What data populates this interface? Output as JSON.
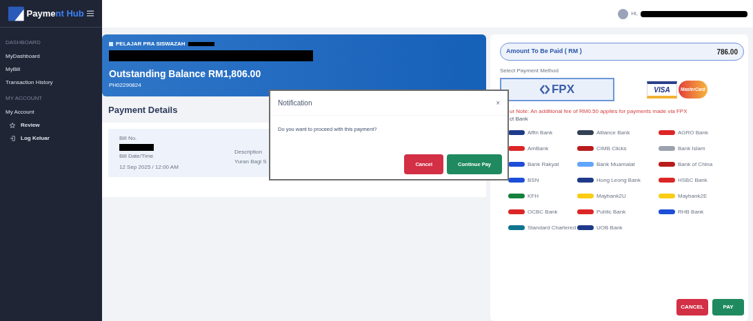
{
  "logo": {
    "parts": [
      {
        "text": "Payme",
        "color": "#ffffff"
      },
      {
        "text": "nt Hub",
        "color": "#3b82f6"
      }
    ]
  },
  "sidebar": {
    "sections": [
      {
        "heading": "DASHBOARD",
        "items": [
          {
            "label": "MyDashboard",
            "kind": "plain"
          },
          {
            "label": "MyBill",
            "kind": "plain"
          },
          {
            "label": "Transaction History",
            "kind": "plain"
          }
        ]
      },
      {
        "heading": "MY ACCOUNT",
        "items": [
          {
            "label": "My Account",
            "kind": "plain"
          },
          {
            "label": "Review",
            "kind": "star"
          },
          {
            "label": "Log Keluar",
            "kind": "logout"
          }
        ]
      }
    ]
  },
  "topbar": {
    "greeting": "Hi,"
  },
  "student_card": {
    "category": "PELAJAR PRA SISWAZAH",
    "balance": "Outstanding Balance RM1,806.00",
    "code": "PH02290824"
  },
  "payment_details": {
    "title": "Payment Details",
    "bill_no_label": "Bill No.",
    "date_label": "Bill Date/Time",
    "date": "12 Sep 2025 / 12:00 AM",
    "description_label": "Description",
    "description": "Yuran Bagi S"
  },
  "modal": {
    "title": "Notification",
    "close": "×",
    "message": "Do you want to proceed with this payment?",
    "buttons": [
      {
        "label": "Cancel",
        "kind": "danger"
      },
      {
        "label": "Continue Pay",
        "kind": "success"
      }
    ]
  },
  "payment": {
    "amount_label": "Amount To Be Paid ( RM )",
    "amount": "786.00",
    "method_label": "Select Payment Method",
    "methods": [
      {
        "kind": "fpx",
        "label": "FPX",
        "selected": true
      },
      {
        "kind": "card",
        "visa": "VISA",
        "mastercard": "MasterCard",
        "selected": false
      }
    ],
    "note": "ur Note: An additional fee of RM0.50 applies for payments made via FPX",
    "bank_label": "ct Bank",
    "banks": [
      {
        "name": "Affin Bank",
        "color": "#1e3a8a"
      },
      {
        "name": "Alliance Bank",
        "color": "#334155"
      },
      {
        "name": "AGRO Bank",
        "color": "#dc2626"
      },
      {
        "name": "AmBank",
        "color": "#dc2626"
      },
      {
        "name": "CIMB Clicks",
        "color": "#b91c1c"
      },
      {
        "name": "Bank Islam",
        "color": "#9ca3af"
      },
      {
        "name": "Bank Rakyat",
        "color": "#1d4ed8"
      },
      {
        "name": "Bank Muamalat",
        "color": "#60a5fa"
      },
      {
        "name": "Bank of China",
        "color": "#b91c1c"
      },
      {
        "name": "BSN",
        "color": "#1d4ed8"
      },
      {
        "name": "Hong Leong Bank",
        "color": "#1e3a8a"
      },
      {
        "name": "HSBC Bank",
        "color": "#dc2626"
      },
      {
        "name": "KFH",
        "color": "#15803d"
      },
      {
        "name": "Maybank2U",
        "color": "#facc15"
      },
      {
        "name": "Maybank2E",
        "color": "#facc15"
      },
      {
        "name": "OCBC Bank",
        "color": "#dc2626"
      },
      {
        "name": "Public Bank",
        "color": "#dc2626"
      },
      {
        "name": "RHB Bank",
        "color": "#1d4ed8"
      },
      {
        "name": "Standard Chartered",
        "color": "#0e7490"
      },
      {
        "name": "UOB Bank",
        "color": "#1e3a8a"
      }
    ],
    "actions": [
      {
        "label": "CANCEL",
        "kind": "danger"
      },
      {
        "label": "PAY",
        "kind": "success"
      }
    ]
  }
}
